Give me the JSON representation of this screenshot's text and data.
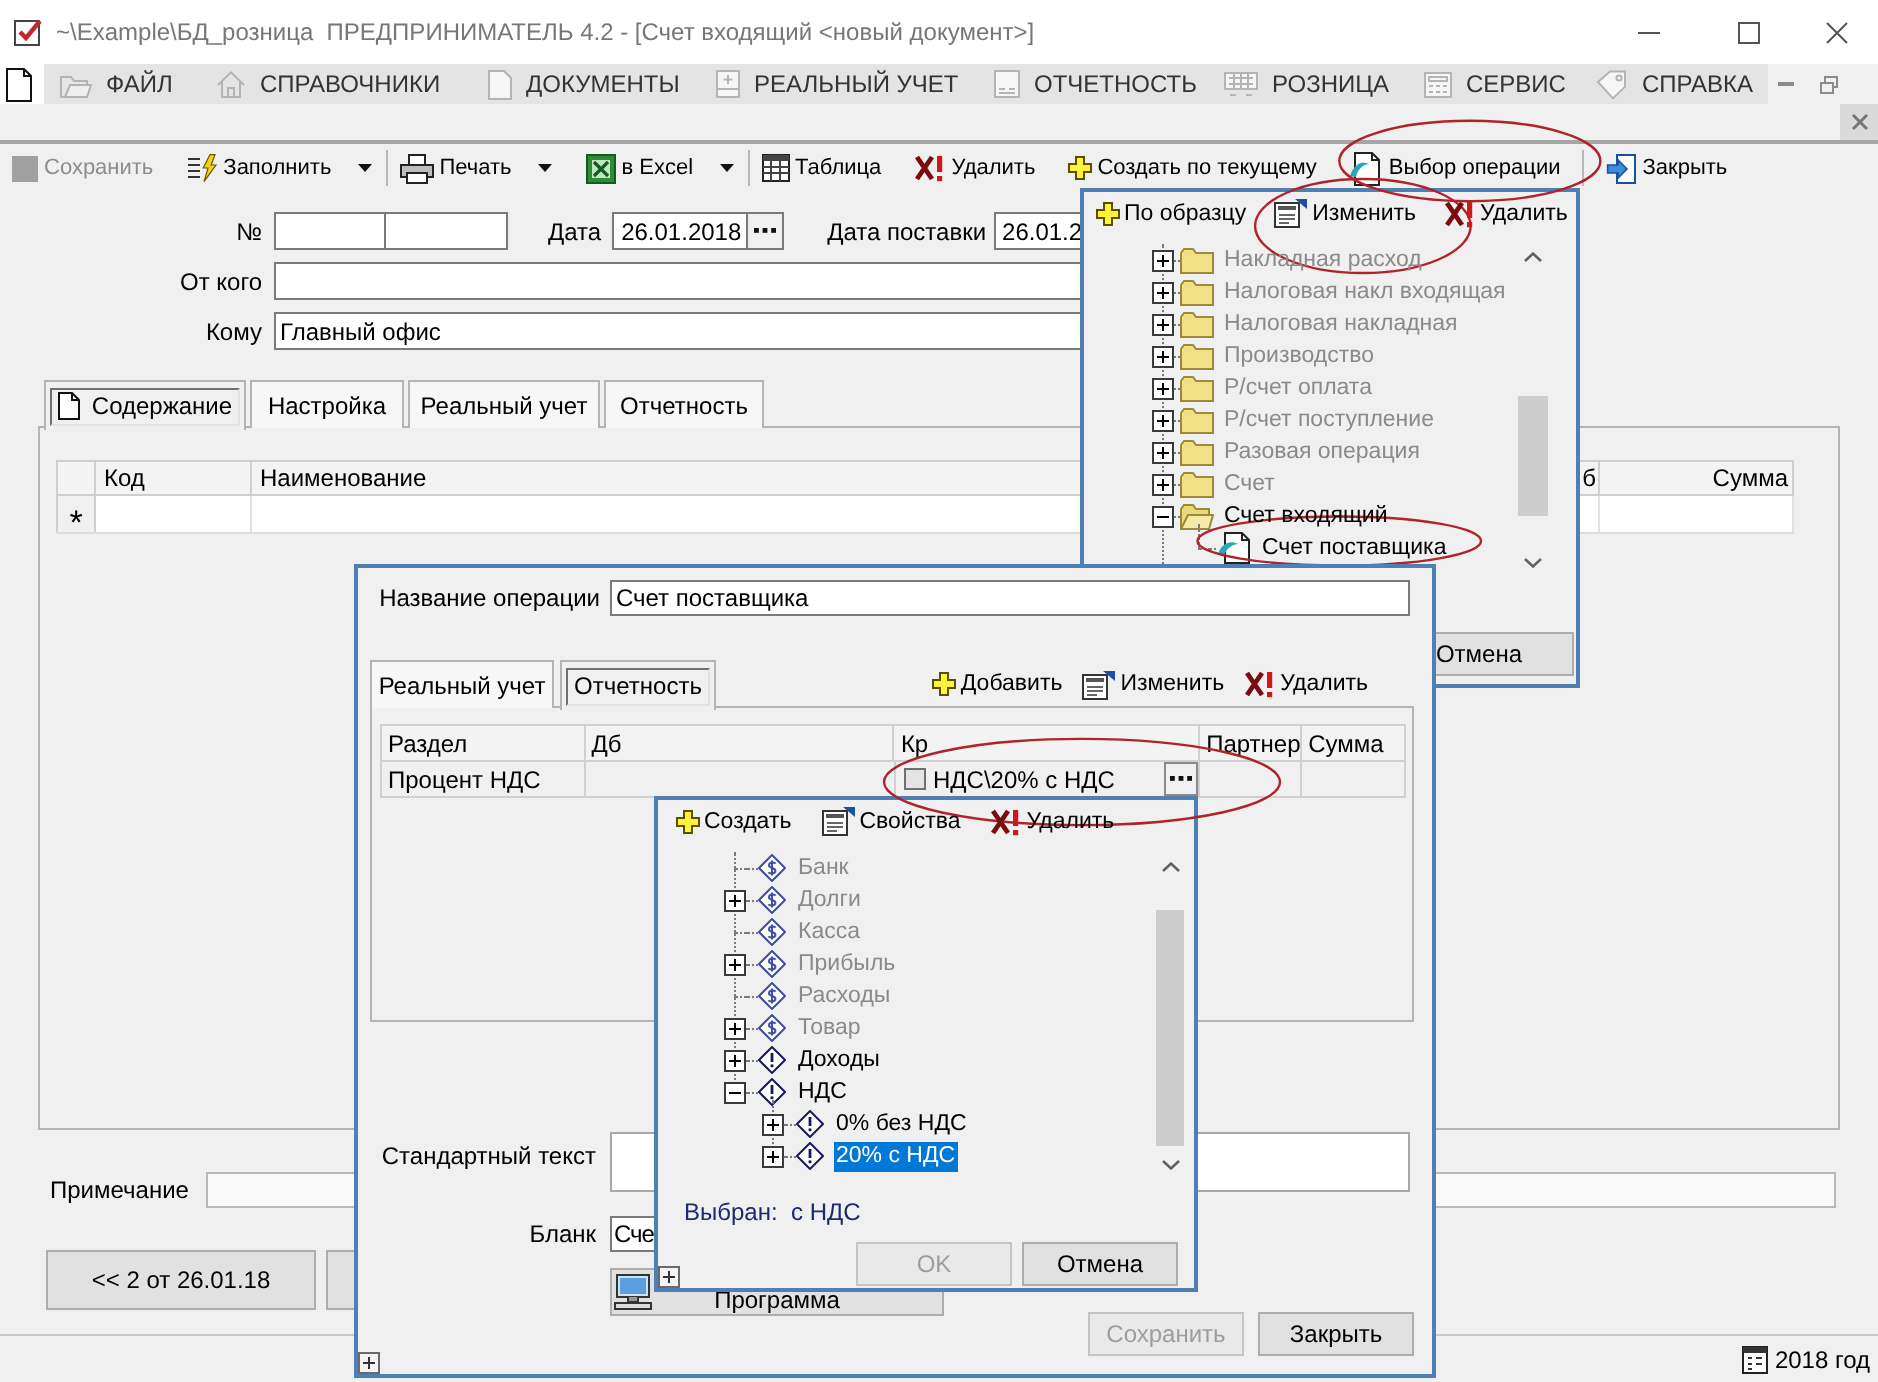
{
  "window": {
    "title": "~\\Example\\БД_розница  ПРЕДПРИНИМАТЕЛЬ 4.2 - [Счет входящий <новый документ>]"
  },
  "menu": [
    {
      "label": "ФАЙЛ"
    },
    {
      "label": "СПРАВОЧНИКИ"
    },
    {
      "label": "ДОКУМЕНТЫ"
    },
    {
      "label": "РЕАЛЬНЫЙ УЧЕТ"
    },
    {
      "label": "ОТЧЕТНОСТЬ"
    },
    {
      "label": "РОЗНИЦА"
    },
    {
      "label": "СЕРВИС"
    },
    {
      "label": "СПРАВКА"
    }
  ],
  "toolbar": [
    [
      {
        "label": "Сохранить",
        "disabled": true
      },
      {
        "label": "Заполнить",
        "disabled": false,
        "dropdown": true
      }
    ],
    [
      {
        "label": "Печать",
        "disabled": false,
        "dropdown": true
      },
      {
        "label": "в Excel",
        "disabled": false,
        "dropdown": true
      }
    ],
    [
      {
        "label": "Таблица",
        "disabled": false
      },
      {
        "label": "Удалить",
        "disabled": false
      },
      {
        "label": "Создать по текущему",
        "disabled": false
      },
      {
        "label": "Выбор операции",
        "disabled": false,
        "circled": true
      }
    ],
    [
      {
        "label": "Закрыть",
        "disabled": false
      }
    ]
  ],
  "form": {
    "number_label": "№",
    "date_label": "Дата",
    "date": "26.01.2018",
    "delivery_date_label": "Дата поставки",
    "delivery_date": "26.01.2",
    "from_label": "От кого",
    "to_label": "Кому",
    "to": "Главный офис"
  },
  "tabs": [
    {
      "label": "Содержание",
      "selected": true
    },
    {
      "label": "Настройка",
      "selected": false
    },
    {
      "label": "Реальный учет",
      "selected": false
    },
    {
      "label": "Отчетность",
      "selected": false
    }
  ],
  "table": {
    "columns": [
      "Код",
      "Наименование",
      "б",
      "Сумма"
    ],
    "new_row_marker": "*"
  },
  "note_label": "Примечание",
  "nav_button": "<< 2 от 26.01.18",
  "status_bar": {
    "period": "2018 год"
  },
  "operation_picker": {
    "toolbar": [
      {
        "label": "По образцу"
      },
      {
        "label": "Изменить",
        "circled": true
      },
      {
        "label": "Удалить"
      }
    ],
    "tree": [
      {
        "label": "Накладная расход",
        "kind": "folder",
        "expanded": false,
        "disabled": true,
        "selected": false
      },
      {
        "label": "Налоговая накл входящая",
        "kind": "folder",
        "expanded": false,
        "disabled": true,
        "selected": false
      },
      {
        "label": "Налоговая накладная",
        "kind": "folder",
        "expanded": false,
        "disabled": true,
        "selected": false
      },
      {
        "label": "Производство",
        "kind": "folder",
        "expanded": false,
        "disabled": true,
        "selected": false
      },
      {
        "label": "Р/счет оплата",
        "kind": "folder",
        "expanded": false,
        "disabled": true,
        "selected": false
      },
      {
        "label": "Р/счет поступление",
        "kind": "folder",
        "expanded": false,
        "disabled": true,
        "selected": false
      },
      {
        "label": "Разовая операция",
        "kind": "folder",
        "expanded": false,
        "disabled": true,
        "selected": false
      },
      {
        "label": "Счет",
        "kind": "folder",
        "expanded": false,
        "disabled": true,
        "selected": false
      },
      {
        "label": "Счет входящий",
        "kind": "folder",
        "expanded": true,
        "disabled": false,
        "selected": false,
        "children": [
          {
            "label": "Счет поставщика",
            "kind": "operation",
            "disabled": false,
            "selected": false,
            "circled": true
          }
        ]
      }
    ],
    "cancel": "Отмена"
  },
  "operation_dialog": {
    "name_label": "Название операции",
    "name": "Счет поставщика",
    "tabs": [
      {
        "label": "Реальный учет",
        "selected": false
      },
      {
        "label": "Отчетность",
        "selected": true
      }
    ],
    "toolbar": [
      {
        "label": "Добавить"
      },
      {
        "label": "Изменить"
      },
      {
        "label": "Удалить"
      }
    ],
    "table": {
      "columns": [
        "Раздел",
        "Дб",
        "Кр",
        "Партнер",
        "Сумма"
      ],
      "rows": [
        {
          "section": "Процент НДС",
          "credit": "НДС\\20% с НДС",
          "checked": false,
          "circled": true
        }
      ]
    },
    "standard_text_label": "Стандартный текст",
    "form_label": "Бланк",
    "form_value": "Сче",
    "program_button": "Программа",
    "buttons": [
      {
        "label": "Сохранить",
        "disabled": true
      },
      {
        "label": "Закрыть",
        "disabled": false
      }
    ]
  },
  "account_picker": {
    "toolbar": [
      {
        "label": "Создать"
      },
      {
        "label": "Свойства"
      },
      {
        "label": "Удалить"
      }
    ],
    "tree": [
      {
        "label": "Банк",
        "kind": "account",
        "disabled": true,
        "selected": false
      },
      {
        "label": "Долги",
        "kind": "account",
        "expanded": false,
        "disabled": true,
        "selected": false
      },
      {
        "label": "Касса",
        "kind": "account",
        "disabled": true,
        "selected": false
      },
      {
        "label": "Прибыль",
        "kind": "account",
        "expanded": false,
        "disabled": true,
        "selected": false
      },
      {
        "label": "Расходы",
        "kind": "account",
        "disabled": true,
        "selected": false
      },
      {
        "label": "Товар",
        "kind": "account",
        "expanded": false,
        "disabled": true,
        "selected": false
      },
      {
        "label": "Доходы",
        "kind": "category",
        "expanded": false,
        "disabled": false,
        "selected": false
      },
      {
        "label": "НДС",
        "kind": "category",
        "expanded": true,
        "disabled": false,
        "selected": false,
        "children": [
          {
            "label": "0% без НДС",
            "kind": "category",
            "expanded": false,
            "disabled": false,
            "selected": false
          },
          {
            "label": "20% с НДС",
            "kind": "category",
            "expanded": false,
            "disabled": false,
            "selected": true
          }
        ]
      }
    ],
    "selection": "Выбран:  с НДС",
    "buttons": [
      {
        "label": "OK",
        "disabled": true
      },
      {
        "label": "Отмена",
        "disabled": false
      }
    ]
  }
}
